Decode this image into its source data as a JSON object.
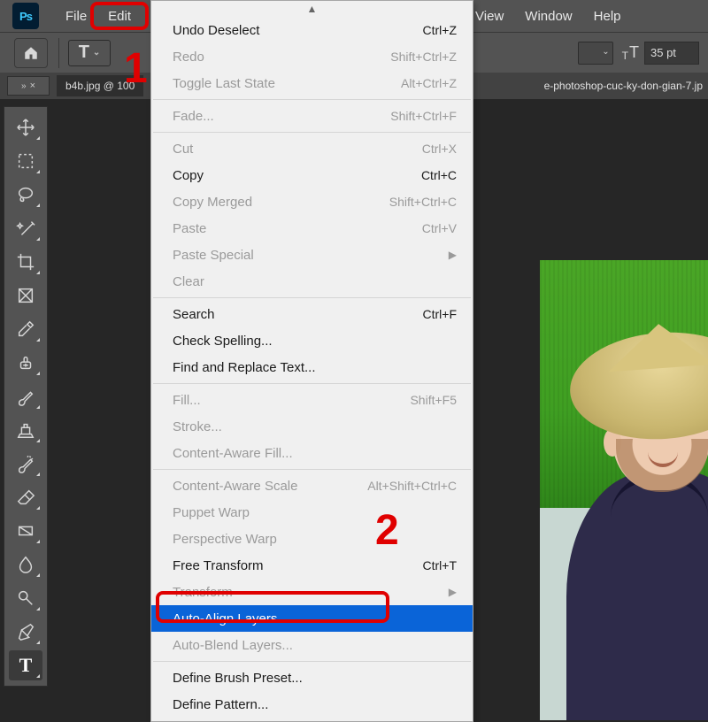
{
  "menubar": {
    "file": "File",
    "edit": "Edit",
    "view": "View",
    "window": "Window",
    "help": "Help"
  },
  "optionbar": {
    "tool_glyph": "T",
    "font_size_value": "35 pt"
  },
  "tabbar": {
    "doc_tab": "b4b.jpg @ 100",
    "right_text": "e-photoshop-cuc-ky-don-gian-7.jp"
  },
  "tab_panel": {
    "chev": "»",
    "close": "×"
  },
  "annotations": {
    "one": "1",
    "two": "2"
  },
  "menu": {
    "undo": {
      "label": "Undo Deselect",
      "shortcut": "Ctrl+Z",
      "enabled": true
    },
    "redo": {
      "label": "Redo",
      "shortcut": "Shift+Ctrl+Z",
      "enabled": false
    },
    "toggle": {
      "label": "Toggle Last State",
      "shortcut": "Alt+Ctrl+Z",
      "enabled": false
    },
    "fade": {
      "label": "Fade...",
      "shortcut": "Shift+Ctrl+F",
      "enabled": false
    },
    "cut": {
      "label": "Cut",
      "shortcut": "Ctrl+X",
      "enabled": false
    },
    "copy": {
      "label": "Copy",
      "shortcut": "Ctrl+C",
      "enabled": true
    },
    "copym": {
      "label": "Copy Merged",
      "shortcut": "Shift+Ctrl+C",
      "enabled": false
    },
    "paste": {
      "label": "Paste",
      "shortcut": "Ctrl+V",
      "enabled": false
    },
    "pastes": {
      "label": "Paste Special",
      "submenu": true,
      "enabled": false
    },
    "clear": {
      "label": "Clear",
      "enabled": false
    },
    "search": {
      "label": "Search",
      "shortcut": "Ctrl+F",
      "enabled": true
    },
    "spell": {
      "label": "Check Spelling...",
      "enabled": true
    },
    "findrep": {
      "label": "Find and Replace Text...",
      "enabled": true
    },
    "fill": {
      "label": "Fill...",
      "shortcut": "Shift+F5",
      "enabled": false
    },
    "stroke": {
      "label": "Stroke...",
      "enabled": false
    },
    "cafill": {
      "label": "Content-Aware Fill...",
      "enabled": false
    },
    "cascale": {
      "label": "Content-Aware Scale",
      "shortcut": "Alt+Shift+Ctrl+C",
      "enabled": false
    },
    "puppet": {
      "label": "Puppet Warp",
      "enabled": false
    },
    "persp": {
      "label": "Perspective Warp",
      "enabled": false
    },
    "freet": {
      "label": "Free Transform",
      "shortcut": "Ctrl+T",
      "enabled": true
    },
    "transf": {
      "label": "Transform",
      "submenu": true,
      "enabled": false
    },
    "autoalign": {
      "label": "Auto-Align Layers...",
      "enabled": true,
      "highlighted": true
    },
    "autoblend": {
      "label": "Auto-Blend Layers...",
      "enabled": false
    },
    "brushpreset": {
      "label": "Define Brush Preset...",
      "enabled": true
    },
    "pattern": {
      "label": "Define Pattern...",
      "enabled": true
    }
  }
}
